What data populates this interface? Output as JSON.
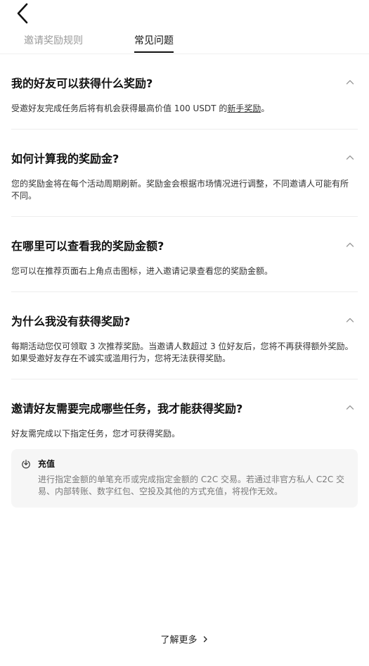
{
  "header": {
    "back_icon": "chevron-left-icon"
  },
  "tabs": [
    {
      "label": "邀请奖励规则",
      "active": false
    },
    {
      "label": "常见问题",
      "active": true
    }
  ],
  "faq": [
    {
      "question": "我的好友可以获得什么奖励?",
      "answer_prefix": "受邀好友完成任务后将有机会获得最高价值 100 USDT 的",
      "answer_link": "新手奖励",
      "answer_suffix": "。"
    },
    {
      "question": "如何计算我的奖励金?",
      "answer": "您的奖励金将在每个活动周期刷新。奖励金会根据市场情况进行调整，不同邀请人可能有所不同。"
    },
    {
      "question": "在哪里可以查看我的奖励金额?",
      "answer": "您可以在推荐页面右上角点击图标，进入邀请记录查看您的奖励金额。"
    },
    {
      "question": "为什么我没有获得奖励?",
      "answer": "每期活动您仅可领取 3 次推荐奖励。当邀请人数超过 3 位好友后，您将不再获得额外奖励。如果受邀好友存在不诚实或滥用行为，您将无法获得奖励。"
    },
    {
      "question": "邀请好友需要完成哪些任务，我才能获得奖励?",
      "answer": "好友需完成以下指定任务，您才可获得奖励。",
      "task": {
        "icon": "deposit-icon",
        "title": "充值",
        "description": "进行指定金额的单笔充币或完成指定金额的 C2C 交易。若通过非官方私人 C2C 交易、内部转账、数字红包、空投及其他的方式充值，将视作无效。"
      }
    }
  ],
  "footer": {
    "learn_more": "了解更多"
  },
  "colors": {
    "text_primary": "#111111",
    "text_secondary": "#333333",
    "text_muted": "#9a9a9a",
    "task_bg": "#f6f6f6",
    "divider": "#eeeeee"
  }
}
